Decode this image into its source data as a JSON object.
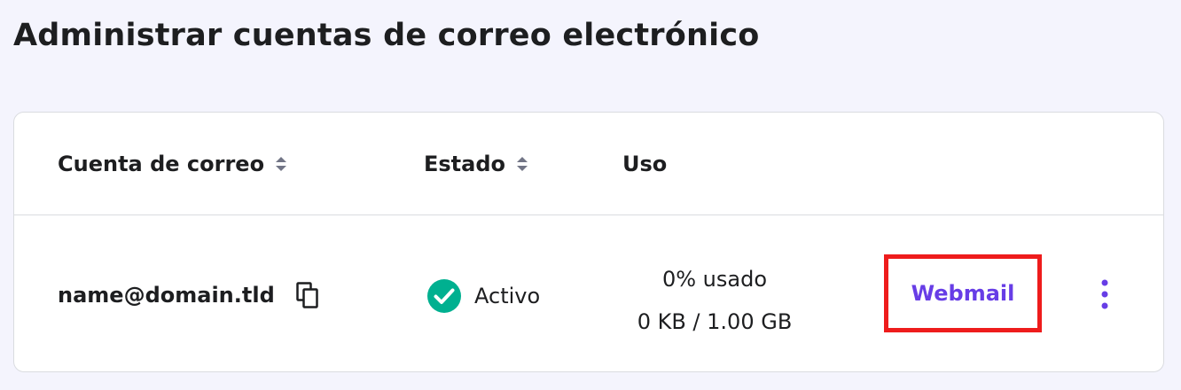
{
  "page": {
    "title": "Administrar cuentas de correo electrónico"
  },
  "table": {
    "columns": [
      {
        "label": "Cuenta de correo",
        "sortable": true
      },
      {
        "label": "Estado",
        "sortable": true
      },
      {
        "label": "Uso",
        "sortable": false
      }
    ],
    "rows": [
      {
        "email": "name@domain.tld",
        "status": "Activo",
        "usage_percent": "0% usado",
        "usage_amount": "0 KB / 1.00 GB",
        "action_label": "Webmail"
      }
    ]
  },
  "icons": {
    "sort": "sort-icon",
    "copy": "copy-icon",
    "status": "check-circle-icon",
    "more": "more-vertical-icon"
  },
  "colors": {
    "background": "#f4f4fd",
    "accent": "#673de6",
    "success": "#00b090",
    "highlight_border": "#ee1c1c",
    "text": "#1d1e20"
  }
}
